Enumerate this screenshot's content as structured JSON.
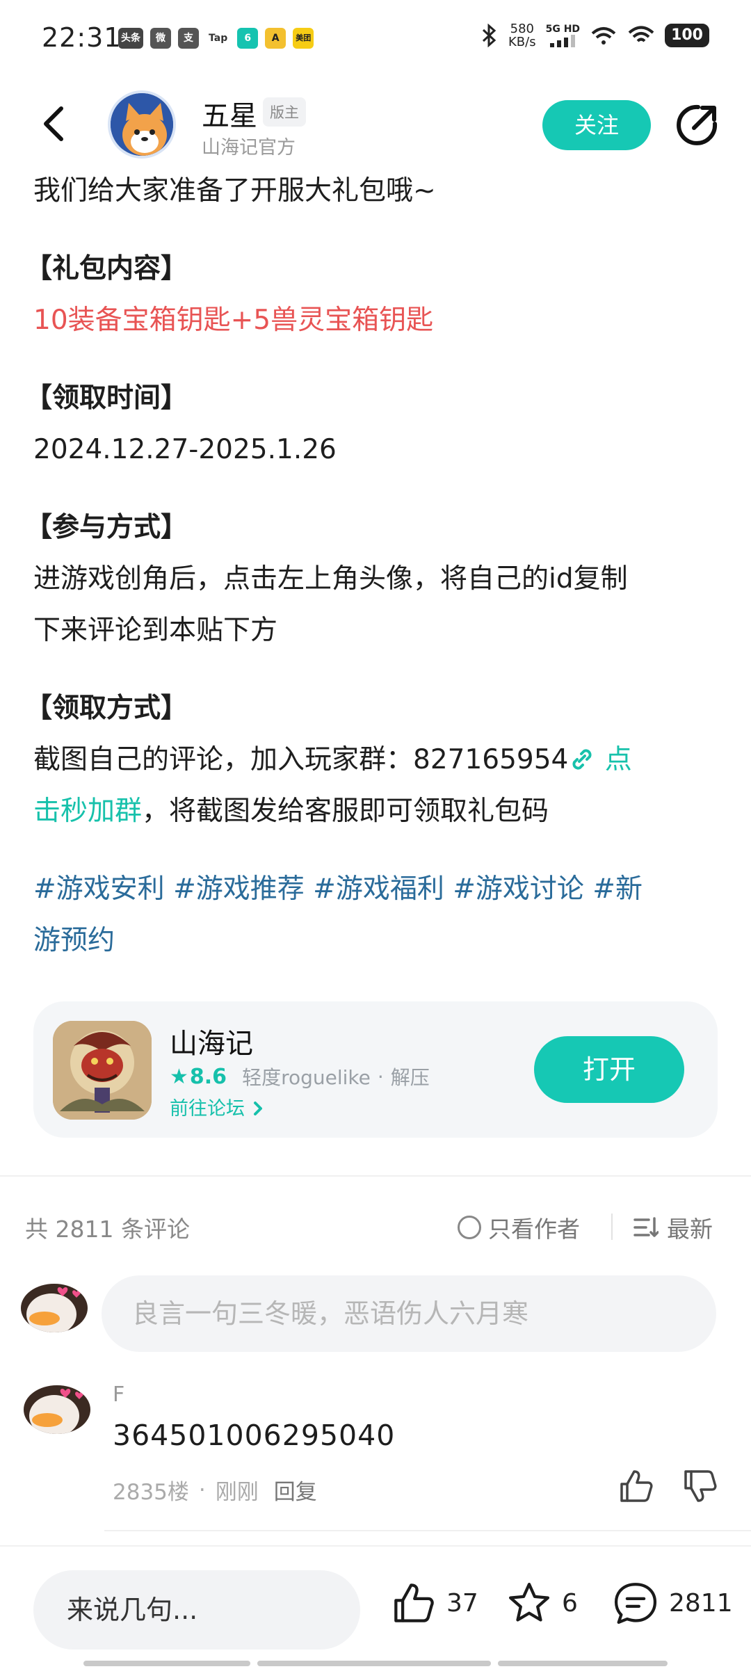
{
  "status_bar": {
    "time": "22:31",
    "apps": [
      "头条",
      "微",
      "支",
      "Tap",
      "6",
      "A",
      "美团"
    ],
    "net_speed_value": "580",
    "net_speed_unit": "KB/s",
    "signal_label": "5G HD",
    "battery": "100"
  },
  "header": {
    "author_name": "五星",
    "mod_badge": "版主",
    "author_sub": "山海记官方",
    "follow_label": "关注"
  },
  "post": {
    "intro": "我们给大家准备了开服大礼包哦~",
    "gift_heading": "【礼包内容】",
    "gift_content": "10装备宝箱钥匙+5兽灵宝箱钥匙",
    "time_heading": "【领取时间】",
    "time_content": "2024.12.27-2025.1.26",
    "join_heading": "【参与方式】",
    "join_line1": "进游戏创角后，点击左上角头像，将自己的id复制",
    "join_line2": "下来评论到本贴下方",
    "claim_heading": "【领取方式】",
    "claim_line1_pre": "截图自己的评论，加入玩家群：827165954",
    "claim_link_part1": " 点",
    "claim_link_part2": "击秒加群",
    "claim_line2_post": "，将截图发给客服即可领取礼包码",
    "tags_line1": "#游戏安利 #游戏推荐 #游戏福利 #游戏讨论 #新",
    "tags_line2": "游预约"
  },
  "game_card": {
    "name": "山海记",
    "rating": "8.6",
    "genre": "轻度roguelike",
    "dot": "·",
    "tag2": "解压",
    "forum_link": "前往论坛",
    "open_label": "打开"
  },
  "comments": {
    "count_label": "共 2811 条评论",
    "author_only_label": "只看作者",
    "sort_label": "最新",
    "input_placeholder": "良言一句三冬暖，恶语伤人六月寒",
    "items": [
      {
        "name": "F",
        "text": "364501006295040",
        "floor": "2835楼",
        "dot": "·",
        "time": "刚刚",
        "reply": "回复"
      }
    ]
  },
  "bottom_bar": {
    "reply_placeholder": "来说几句...",
    "likes": "37",
    "favorites": "6",
    "comments": "2811"
  },
  "colors": {
    "accent": "#16c8b4",
    "gift_red": "#e85454",
    "tag_blue": "#2a6b9a"
  },
  "icons": [
    "back-arrow-icon",
    "share-icon",
    "link-icon",
    "star-icon",
    "chevron-right-icon",
    "radio-icon",
    "sort-icon",
    "thumb-up-icon",
    "thumb-down-icon",
    "like-icon",
    "favorite-star-icon",
    "comment-icon"
  ]
}
